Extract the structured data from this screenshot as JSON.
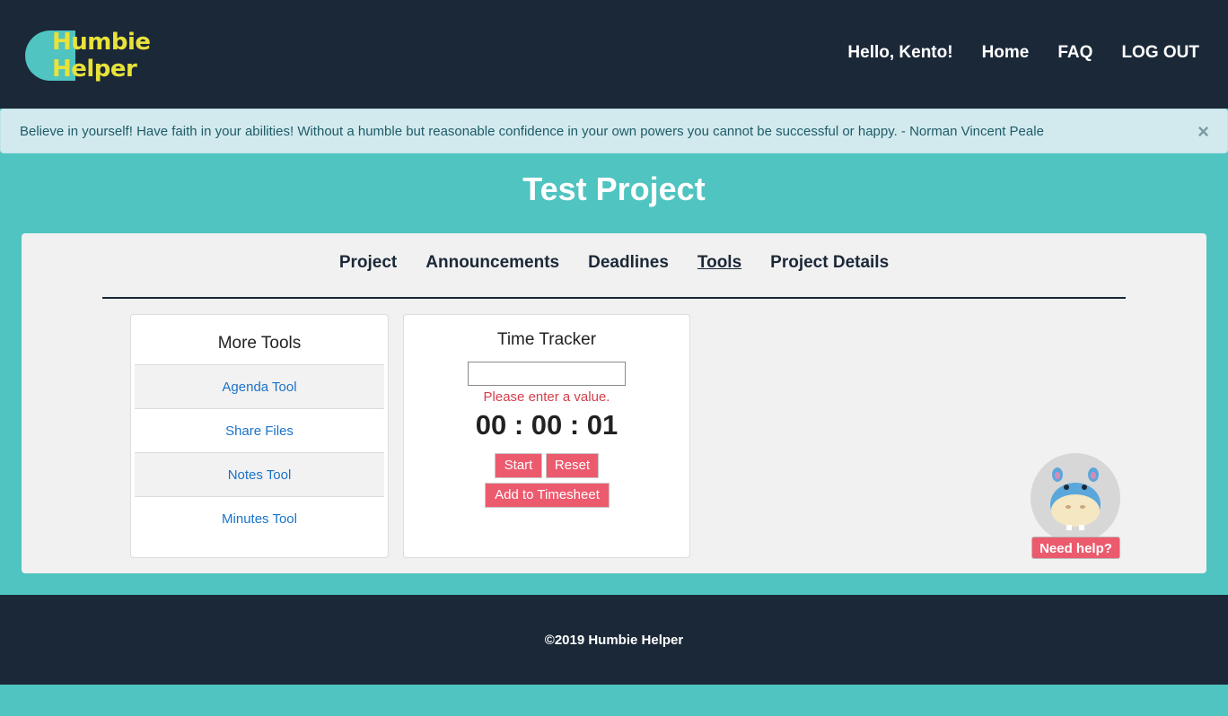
{
  "header": {
    "logo_line1": "Humbie",
    "logo_line2": "Helper",
    "greeting": "Hello, Kento!",
    "nav": {
      "home": "Home",
      "faq": "FAQ",
      "logout": "LOG OUT"
    },
    "colors": {
      "bar": "#1b2838",
      "logo_text": "#e8e23a",
      "accent": "#4fc4c1"
    }
  },
  "alert": {
    "quote": "Believe in yourself! Have faith in your abilities! Without a humble but reasonable confidence in your own powers you cannot be successful or happy. - Norman Vincent Peale",
    "close_icon": "×"
  },
  "page": {
    "title": "Test Project"
  },
  "tabs": [
    "Project",
    "Announcements",
    "Deadlines",
    "Tools",
    "Project Details"
  ],
  "active_tab": "Tools",
  "more_tools": {
    "title": "More Tools",
    "items": [
      "Agenda Tool",
      "Share Files",
      "Notes Tool",
      "Minutes Tool"
    ]
  },
  "time_tracker": {
    "title": "Time Tracker",
    "input_value": "",
    "error": "Please enter a value.",
    "clock": "00 : 00 : 01",
    "start_label": "Start",
    "reset_label": "Reset",
    "add_label": "Add to Timesheet"
  },
  "helper": {
    "label": "Need help?",
    "mascot_icon": "hippo-icon"
  },
  "footer": {
    "copyright": "©2019 Humbie Helper"
  },
  "colors": {
    "button": "#ec5a6e",
    "link": "#1a73c9",
    "error": "#d43f4a"
  }
}
